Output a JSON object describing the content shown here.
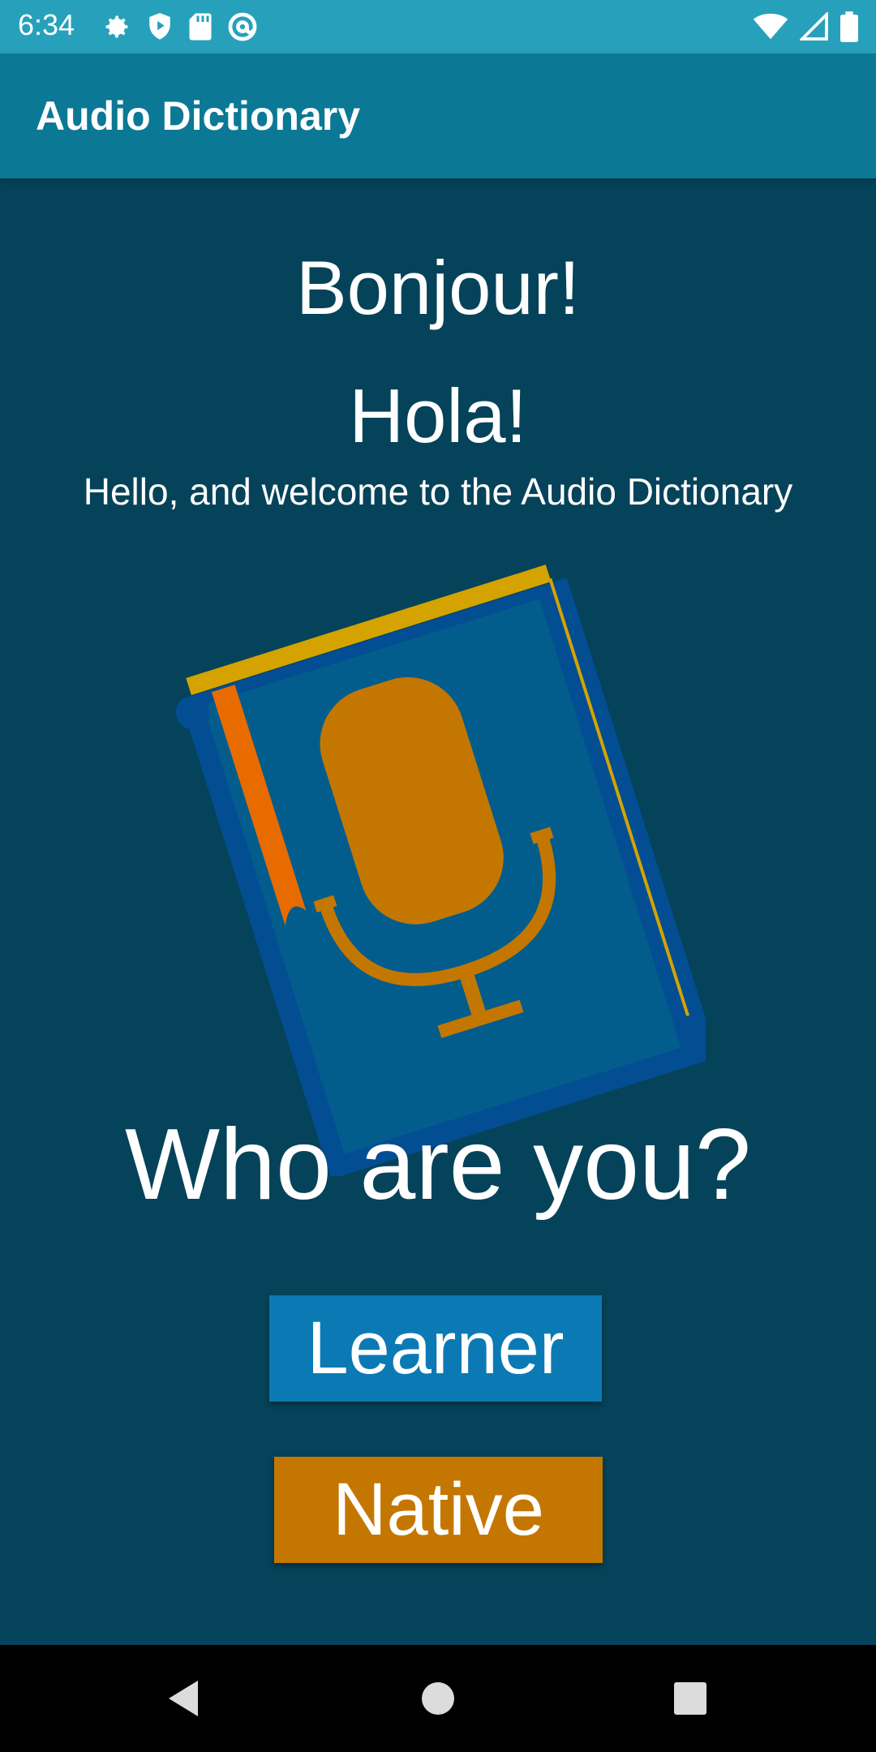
{
  "status_bar": {
    "time": "6:34",
    "left_icons": [
      "gear-icon",
      "shield-play-icon",
      "sd-card-icon",
      "at-sign-icon"
    ],
    "right_icons": [
      "wifi-icon",
      "cell-signal-icon",
      "battery-icon"
    ]
  },
  "app_bar": {
    "title": "Audio Dictionary"
  },
  "main": {
    "greeting_french": "Bonjour!",
    "greeting_spanish": "Hola!",
    "welcome_text": "Hello, and welcome to the Audio Dictionary",
    "illustration": "book-microphone-illustration",
    "question": "Who are you?",
    "learner_label": "Learner",
    "native_label": "Native"
  },
  "colors": {
    "status_bar": "#27a1bb",
    "app_bar": "#0b7896",
    "background": "#05435a",
    "learner_button": "#0b7ab4",
    "native_button": "#c47700"
  },
  "nav_bar": {
    "icons": [
      "back-icon",
      "home-icon",
      "recents-icon"
    ]
  }
}
